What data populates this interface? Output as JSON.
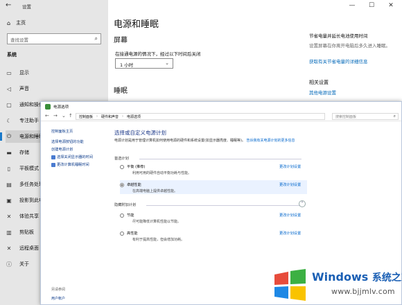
{
  "settings": {
    "title": "设置",
    "controls": [
      "—",
      "☐",
      "✕"
    ],
    "home": "主页",
    "search_placeholder": "查找设置",
    "system_label": "系统",
    "nav": [
      {
        "label": "显示",
        "icon": "monitor-icon"
      },
      {
        "label": "声音",
        "icon": "speaker-icon"
      },
      {
        "label": "通知和操作",
        "icon": "notification-icon"
      },
      {
        "label": "专注助手",
        "icon": "moon-icon"
      },
      {
        "label": "电源和睡眠",
        "icon": "power-icon",
        "active": true
      },
      {
        "label": "存储",
        "icon": "storage-icon"
      },
      {
        "label": "平板模式",
        "icon": "tablet-icon"
      },
      {
        "label": "多任务处理",
        "icon": "multitask-icon"
      },
      {
        "label": "投影到此电",
        "icon": "project-icon"
      },
      {
        "label": "体验共享",
        "icon": "share-icon"
      },
      {
        "label": "剪贴板",
        "icon": "clipboard-icon"
      },
      {
        "label": "远程桌面",
        "icon": "remote-icon"
      },
      {
        "label": "关于",
        "icon": "info-icon"
      }
    ],
    "page_title": "电源和睡眠",
    "screen_heading": "屏幕",
    "screen_label": "在接通电源的情况下，经过以下时间后关闭",
    "screen_value": "1 小时",
    "sleep_heading": "睡眠",
    "right_title": "节省电量并延长电池使用时间",
    "right_desc": "设置屏幕在你离开电脑后多久进入睡眠。",
    "right_link": "获取有关节省电量的详细信息",
    "related_title": "相关设置",
    "related_link": "其他电源设置"
  },
  "control_panel": {
    "title": "电源选项",
    "breadcrumb": [
      "控制面板",
      "硬件和声音",
      "电源选项"
    ],
    "search_placeholder": "搜索控制面板",
    "left_links": {
      "home": "控制面板主页",
      "items": [
        "选择电源按钮的功能",
        "创建电源计划",
        "选择关闭显示器的时间",
        "更改计算机睡眠时间"
      ]
    },
    "see_also": "另请参阅",
    "user_accounts": "用户帐户",
    "heading": "选择或自定义电源计划",
    "intro": "电源计划是用于管理计算机如何使用电源的硬件和系统设置(如显示器亮度、睡眠等)。",
    "intro_link": "告诉我有关电源计划的更多信息",
    "selected_section": "首选计划",
    "hidden_section": "隐藏附加计划",
    "plans": [
      {
        "name": "平衡 (推荐)",
        "desc": "利用可用的硬件自动平衡功耗与性能。",
        "link": "更改计划设置",
        "selected": false
      },
      {
        "name": "卓越性能",
        "desc": "在高端电脑上提供卓越性能。",
        "link": "更改计划设置",
        "selected": true
      },
      {
        "name": "节能",
        "desc": "尽可能降低计算机性能以节能。",
        "link": "更改计划设置",
        "selected": false
      },
      {
        "name": "高性能",
        "desc": "有利于提高性能，但会增加功耗。",
        "link": "更改计划设置",
        "selected": false
      }
    ]
  },
  "watermark": {
    "brand": "Windows",
    "brand_cn": "系统之家",
    "url": "www.bjjmlv.com"
  }
}
